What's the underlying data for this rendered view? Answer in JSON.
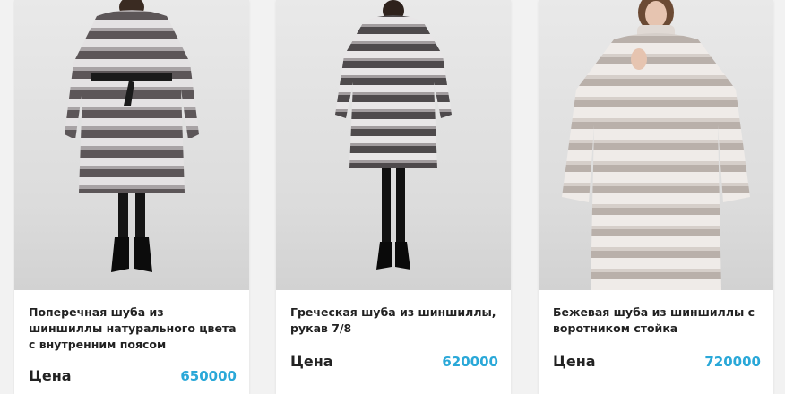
{
  "products": [
    {
      "title": "Поперечная шуба из шиншиллы натурального цвета с внутренним поясом",
      "price_label": "Цена",
      "price": "650000",
      "image_icon": "fur-coat-photo"
    },
    {
      "title": "Греческая шуба из шиншиллы, рукав 7/8",
      "price_label": "Цена",
      "price": "620000",
      "image_icon": "fur-coat-photo"
    },
    {
      "title": "Бежевая шуба из шиншиллы с воротником стойка",
      "price_label": "Цена",
      "price": "720000",
      "image_icon": "fur-coat-photo"
    }
  ],
  "colors": {
    "price": "#2aa8d8",
    "text": "#222222",
    "background": "#f2f2f2",
    "card": "#ffffff"
  }
}
